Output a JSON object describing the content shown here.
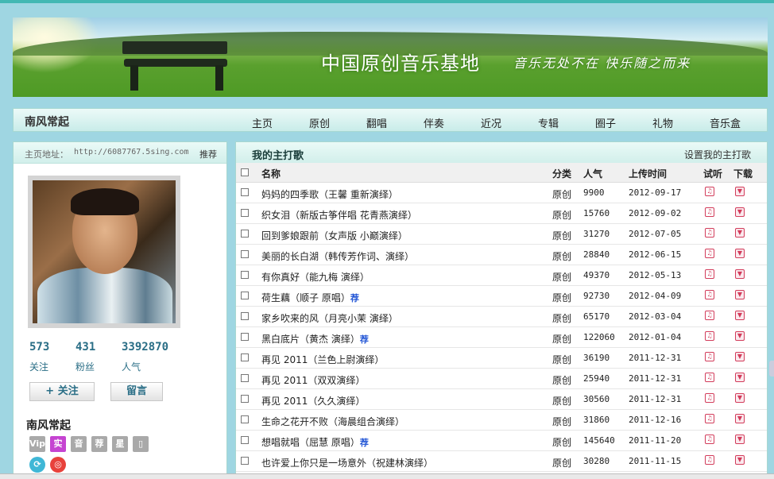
{
  "banner": {
    "title": "中国原创音乐基地",
    "slogan": "音乐无处不在  快乐随之而来"
  },
  "nav": {
    "owner": "南风常起",
    "items": [
      "主页",
      "原创",
      "翻唱",
      "伴奏",
      "近况",
      "专辑",
      "圈子",
      "礼物",
      "音乐盒"
    ]
  },
  "profile": {
    "address_label": "主页地址：",
    "address_url": "http://6087767.5sing.com",
    "recommend": "推荐",
    "stats": [
      {
        "value": "573",
        "label": "关注"
      },
      {
        "value": "431",
        "label": "粉丝"
      },
      {
        "value": "3392870",
        "label": "人气"
      }
    ],
    "follow_label": "+ 关注",
    "message_label": "留言",
    "name": "南风常起",
    "badges": [
      "Vip",
      "实",
      "音",
      "荐",
      "星",
      "▯"
    ]
  },
  "songs": {
    "title": "我的主打歌",
    "set_link": "设置我的主打歌",
    "columns": {
      "name": "名称",
      "category": "分类",
      "popularity": "人气",
      "upload_time": "上传时间",
      "listen": "试听",
      "download": "下载"
    },
    "rows": [
      {
        "name": "妈妈的四季歌（王馨 重新演绎）",
        "rec": "",
        "category": "原创",
        "popularity": "9900",
        "date": "2012-09-17"
      },
      {
        "name": "织女泪（新版古筝伴唱 花青燕演绎）",
        "rec": "",
        "category": "原创",
        "popularity": "15760",
        "date": "2012-09-02"
      },
      {
        "name": "回到爹娘跟前（女声版 小巅演绎）",
        "rec": "",
        "category": "原创",
        "popularity": "31270",
        "date": "2012-07-05"
      },
      {
        "name": "美丽的长白湖（韩传芳作词、演绎）",
        "rec": "",
        "category": "原创",
        "popularity": "28840",
        "date": "2012-06-15"
      },
      {
        "name": "有你真好（能九梅 演绎）",
        "rec": "",
        "category": "原创",
        "popularity": "49370",
        "date": "2012-05-13"
      },
      {
        "name": "荷生藕（顺子 原唱）",
        "rec": "荐",
        "category": "原创",
        "popularity": "92730",
        "date": "2012-04-09"
      },
      {
        "name": "家乡吹来的风（月亮小茉 演绎）",
        "rec": "",
        "category": "原创",
        "popularity": "65170",
        "date": "2012-03-04"
      },
      {
        "name": "黑白底片（黄杰 演绎）",
        "rec": "荐",
        "category": "原创",
        "popularity": "122060",
        "date": "2012-01-04"
      },
      {
        "name": "再见 2011（兰色上尉演绎）",
        "rec": "",
        "category": "原创",
        "popularity": "36190",
        "date": "2011-12-31"
      },
      {
        "name": "再见 2011（双双演绎）",
        "rec": "",
        "category": "原创",
        "popularity": "25940",
        "date": "2011-12-31"
      },
      {
        "name": "再见 2011（久久演绎）",
        "rec": "",
        "category": "原创",
        "popularity": "30560",
        "date": "2011-12-31"
      },
      {
        "name": "生命之花开不败（海晨组合演绎）",
        "rec": "",
        "category": "原创",
        "popularity": "31860",
        "date": "2011-12-16"
      },
      {
        "name": "想唱就唱（屈慧 原唱）",
        "rec": "荐",
        "category": "原创",
        "popularity": "145640",
        "date": "2011-11-20"
      },
      {
        "name": "也许爱上你只是一场意外（祝建林演绎）",
        "rec": "",
        "category": "原创",
        "popularity": "30280",
        "date": "2011-11-15"
      }
    ]
  }
}
